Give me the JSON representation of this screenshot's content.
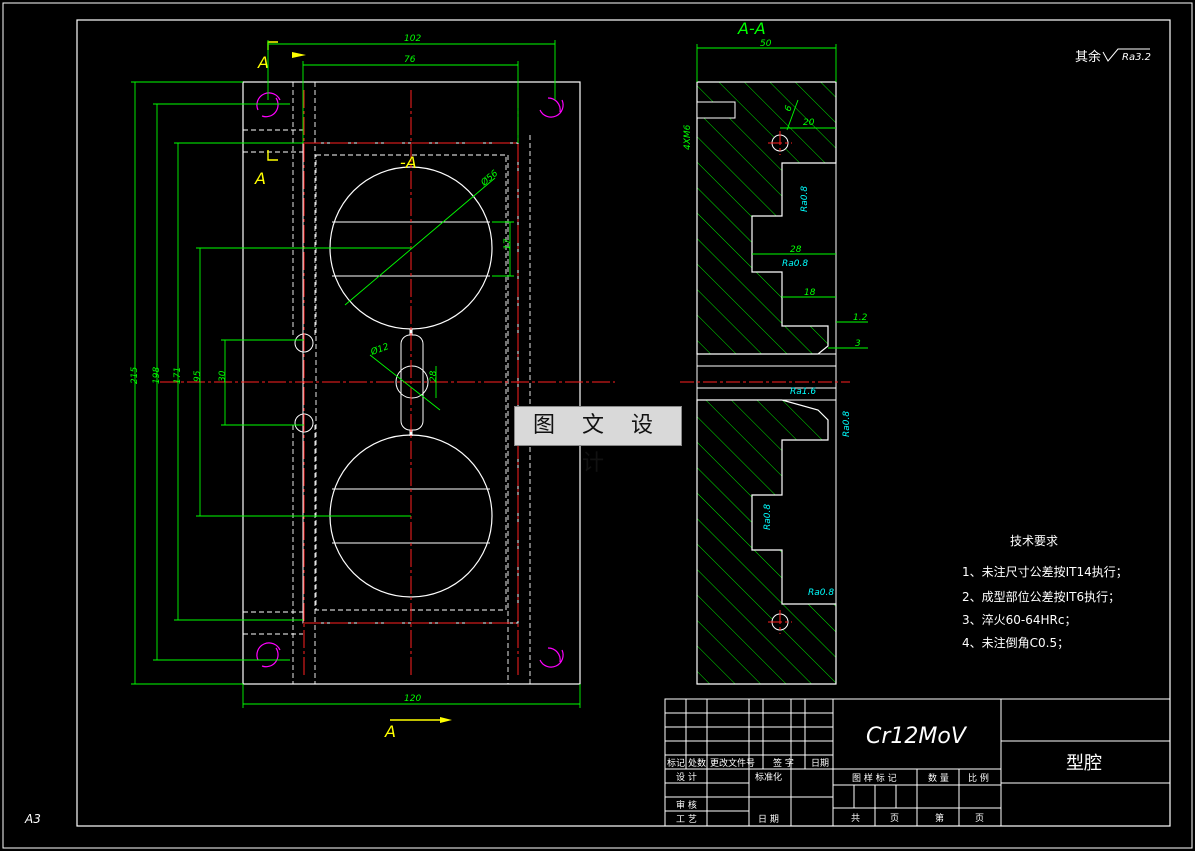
{
  "sheet": {
    "format": "A3"
  },
  "section": {
    "label": "A-A",
    "cut_mark": "A",
    "cut_mark_lower": "A",
    "inline_mark": "-A"
  },
  "surface_note": {
    "text": "其余",
    "ra": "Ra3.2"
  },
  "front_dims": {
    "w_102": "102",
    "w_76": "76",
    "w_120": "120",
    "h_215": "215",
    "h_198": "198",
    "h_171": "171",
    "h_95": "95",
    "h_30": "30",
    "dia_56": "Ø56",
    "dia_12": "Ø12",
    "d_17": "17",
    "d_28": "28"
  },
  "side_dims": {
    "w_50": "50",
    "thread": "4XM6",
    "d_6": "6",
    "d_20": "20",
    "d_28": "28",
    "d_18": "18",
    "d_1_2": "1.2",
    "d_3": "3",
    "ra_08": "Ra0.8",
    "ra_16": "Ra1.6"
  },
  "tech_req": {
    "title": "技术要求",
    "items": [
      "1、未注尺寸公差按IT14执行；",
      "2、成型部位公差按IT6执行；",
      "3、淬火60-64HRc；",
      "4、未注倒角C0.5；"
    ]
  },
  "title_block": {
    "material": "Cr12MoV",
    "part_name": "型腔",
    "h_mark": "标记",
    "h_count": "处数",
    "h_doc": "更改文件号",
    "h_sign": "签  字",
    "h_date": "日期",
    "r_design": "设  计",
    "r_std": "标准化",
    "r_check": "审  核",
    "r_process": "工  艺",
    "r_date": "日  期",
    "c_stage": "图 样 标 记",
    "c_qty": "数  量",
    "c_scale": "比  例",
    "c_total": "共",
    "c_page": "页",
    "c_no": "第",
    "c_page2": "页"
  },
  "watermark": {
    "text": "图 文 设 计"
  },
  "colors": {
    "line": "#ffffff",
    "dim": "#00ff00",
    "center": "#ff2020",
    "hidden": "#ffff00",
    "note": "#00ffff",
    "mark": "#ffff00",
    "thread_arc": "#ff00ff"
  }
}
